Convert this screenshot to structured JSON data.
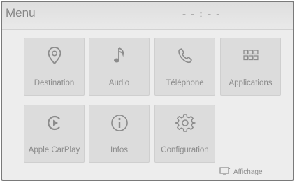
{
  "header": {
    "title": "Menu",
    "clock": "--:--"
  },
  "tiles": [
    {
      "label": "Destination",
      "icon": "map-pin-icon"
    },
    {
      "label": "Audio",
      "icon": "music-note-icon"
    },
    {
      "label": "Téléphone",
      "icon": "phone-icon"
    },
    {
      "label": "Applications",
      "icon": "app-grid-icon"
    },
    {
      "label": "Apple CarPlay",
      "icon": "carplay-icon"
    },
    {
      "label": "Infos",
      "icon": "info-icon"
    },
    {
      "label": "Configuration",
      "icon": "gear-icon"
    }
  ],
  "footer": {
    "display_label": "Affichage",
    "display_icon": "display-icon"
  },
  "colors": {
    "background": "#ededed",
    "tile": "#dcdcdc",
    "text": "#8c8c8c"
  }
}
